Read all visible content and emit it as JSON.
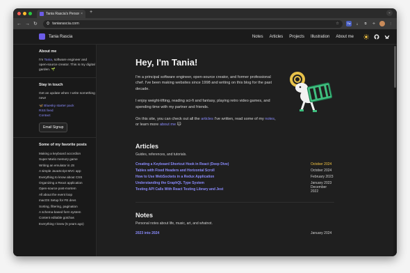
{
  "browser": {
    "tab_title": "Tania Rascia's Personal Web...",
    "tab_close": "×",
    "new_tab": "+",
    "url": "taniarascia.com",
    "colors": {
      "close": "#ff5f57",
      "minimize": "#febc2e",
      "maximize": "#28c840"
    }
  },
  "site": {
    "brand": "Tania Rascia",
    "nav": [
      "Notes",
      "Articles",
      "Projects",
      "Illustration",
      "About me"
    ],
    "accent": "#8b8cff",
    "sidebar": {
      "about_heading": "About me",
      "about_pre": "I'm ",
      "about_link": "Tania",
      "about_post": ", software engineer and open-source creator. This is my digital garden. 🌱",
      "touch_heading": "Stay in touch",
      "touch_text": "Get an update when I write something new!",
      "touch_links": [
        "🦋 Bluesky starter pack",
        "RSS feed",
        "Contact"
      ],
      "signup": "Email Signup",
      "fav_heading": "Some of my favorite posts",
      "favorites": [
        "Making a keyboard accordion",
        "Super Mario memory game",
        "Writing an emulator in JS",
        "A simple JavaScript MVC app",
        "Everything to know about CSS",
        "Organizing a React application",
        "Open-source post-mortem",
        "All about the event loop",
        "macOS Setup for FE devs",
        "Sorting, filtering, pagination",
        "A schema-based form system",
        "Content editable gotchas",
        "Everything I knew (5 years ago)"
      ]
    },
    "hero": {
      "title": "Hey, I'm Tania!",
      "p1": "I'm a principal software engineer, open-source creator, and former professional chef. I've been making websites since 1998 and writing on this blog for the past decade.",
      "p2": "I enjoy weight-lifting, reading sci-fi and fantasy, playing retro video games, and spending time with my partner and friends.",
      "p3_a": "On this site, you can check out all the ",
      "p3_link1": "articles",
      "p3_b": " I've written, read some of my ",
      "p3_link2": "notes",
      "p3_c": ", or learn more ",
      "p3_link3": "about me",
      "p3_d": " 🐱"
    },
    "articles": {
      "heading": "Articles",
      "subtitle": "Guides, references, and tutorials.",
      "items": [
        {
          "title": "Creating a Keyboard Shortcut Hook in React (Deep Dive)",
          "date": "October 2024"
        },
        {
          "title": "Tables with Fixed Headers and Horizontal Scroll",
          "date": "October 2024"
        },
        {
          "title": "How to Use WebSockets in a Redux Application",
          "date": "February 2023"
        },
        {
          "title": "Understanding the GraphQL Type System",
          "date": "January 2023"
        },
        {
          "title": "Testing API Calls With React Testing Library and Jest",
          "date": "December 2022"
        }
      ]
    },
    "notes": {
      "heading": "Notes",
      "subtitle": "Personal notes about life, music, art, and whatnot.",
      "items": [
        {
          "title": "2023 into 2024",
          "date": "January 2024"
        }
      ]
    }
  }
}
